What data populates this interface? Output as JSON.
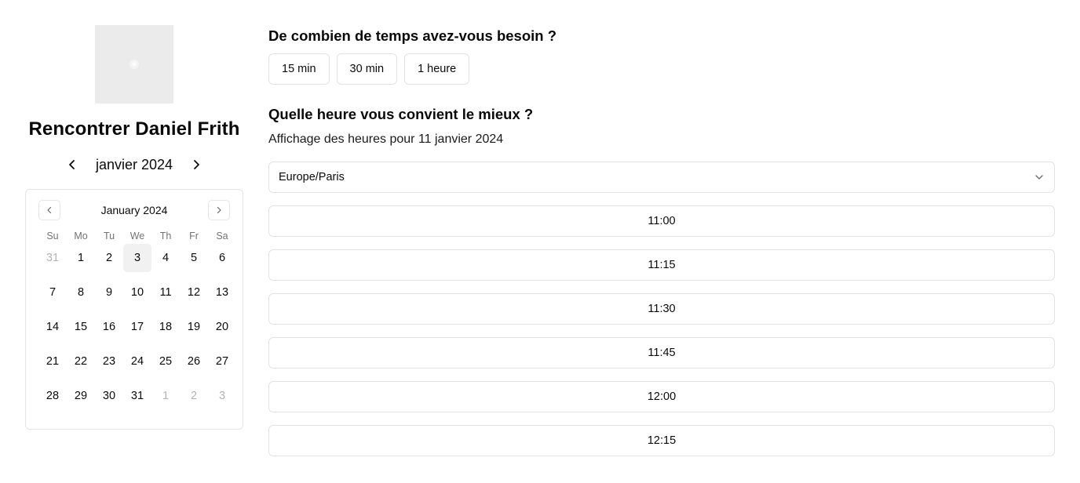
{
  "host": {
    "name": "Rencontrer Daniel Frith"
  },
  "month_nav": {
    "label": "janvier 2024",
    "prev_icon": "chevron-left-icon",
    "next_icon": "chevron-right-icon"
  },
  "calendar": {
    "title": "January 2024",
    "weekdays": [
      "Su",
      "Mo",
      "Tu",
      "We",
      "Th",
      "Fr",
      "Sa"
    ],
    "days": [
      {
        "label": "31",
        "outside": true
      },
      {
        "label": "1"
      },
      {
        "label": "2"
      },
      {
        "label": "3",
        "selected": true
      },
      {
        "label": "4"
      },
      {
        "label": "5"
      },
      {
        "label": "6"
      },
      {
        "label": "7"
      },
      {
        "label": "8"
      },
      {
        "label": "9"
      },
      {
        "label": "10"
      },
      {
        "label": "11"
      },
      {
        "label": "12"
      },
      {
        "label": "13"
      },
      {
        "label": "14"
      },
      {
        "label": "15"
      },
      {
        "label": "16"
      },
      {
        "label": "17"
      },
      {
        "label": "18"
      },
      {
        "label": "19"
      },
      {
        "label": "20"
      },
      {
        "label": "21"
      },
      {
        "label": "22"
      },
      {
        "label": "23"
      },
      {
        "label": "24"
      },
      {
        "label": "25"
      },
      {
        "label": "26"
      },
      {
        "label": "27"
      },
      {
        "label": "28"
      },
      {
        "label": "29"
      },
      {
        "label": "30"
      },
      {
        "label": "31"
      },
      {
        "label": "1",
        "outside": true
      },
      {
        "label": "2",
        "outside": true
      },
      {
        "label": "3",
        "outside": true
      }
    ]
  },
  "duration": {
    "question": "De combien de temps avez-vous besoin ?",
    "options": [
      "15 min",
      "30 min",
      "1 heure"
    ]
  },
  "time": {
    "question": "Quelle heure vous convient le mieux ?",
    "showing": "Affichage des heures pour 11 janvier 2024",
    "timezone": "Europe/Paris",
    "slots": [
      "11:00",
      "11:15",
      "11:30",
      "11:45",
      "12:00",
      "12:15"
    ]
  }
}
